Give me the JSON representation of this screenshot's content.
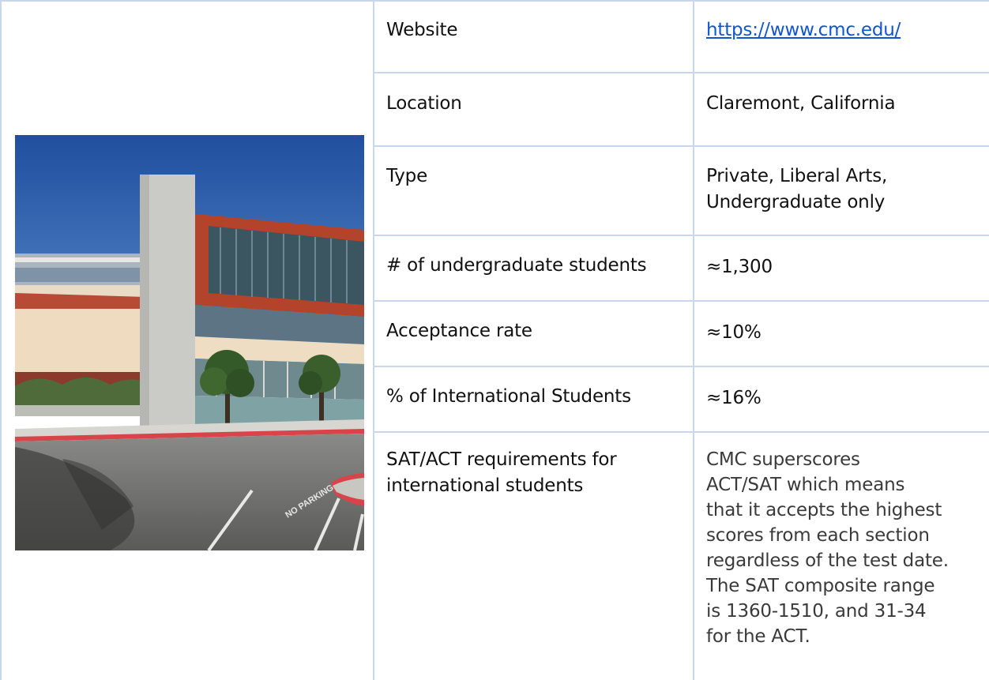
{
  "table": {
    "rows": [
      {
        "label": "Website",
        "value": "https://www.cmc.edu/"
      },
      {
        "label": "Location",
        "value": "Claremont, California"
      },
      {
        "label": "Type",
        "value": "Private, Liberal Arts,\nUndergraduate only"
      },
      {
        "label": "# of undergraduate students",
        "value": "≈1,300"
      },
      {
        "label": "Acceptance rate",
        "value": "≈10%"
      },
      {
        "label": "% of International Students",
        "value": "≈16%"
      },
      {
        "label": "SAT/ACT requirements for\ninternational students",
        "value": "CMC superscores\nACT/SAT which means\nthat it accepts the highest\nscores from each section\nregardless of the test date.\nThe SAT composite range\nis 1360-1510, and 31-34\nfor the ACT."
      }
    ]
  },
  "photo": {
    "painted_text": "NO PARKING",
    "colors": {
      "sky": "#2f5fae",
      "red_facade": "#b3432b",
      "concrete": "#c9c9c6",
      "cream": "#ecd9bd",
      "asphalt": "#6e6e6e",
      "curb": "#d9444a"
    }
  }
}
